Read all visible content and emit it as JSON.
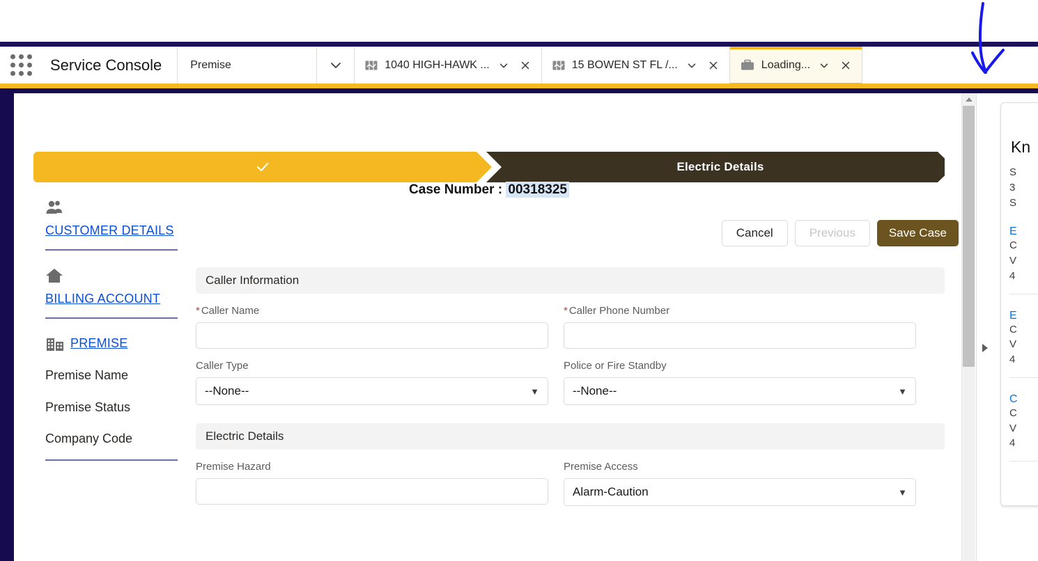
{
  "header": {
    "app_launcher_icon": "app-launcher-grid-icon",
    "app_name": "Service Console",
    "object_tab": "Premise",
    "object_caret_icon": "chevron-down-icon",
    "tabs": [
      {
        "label": "1040 HIGH-HAWK ...",
        "icon": "map-icon",
        "active": false,
        "caret_icon": "chevron-down-icon",
        "close_icon": "close-icon"
      },
      {
        "label": "15 BOWEN ST FL /...",
        "icon": "map-icon",
        "active": false,
        "caret_icon": "chevron-down-icon",
        "close_icon": "close-icon"
      },
      {
        "label": "Loading...",
        "icon": "briefcase-icon",
        "active": true,
        "caret_icon": "chevron-down-icon",
        "close_icon": "close-icon"
      }
    ]
  },
  "path": {
    "completed_step": {
      "label": "",
      "check_icon": "check-icon"
    },
    "current_step": {
      "label": "Electric Details"
    }
  },
  "case": {
    "label": "Case Number :",
    "number": "00318325"
  },
  "actions": {
    "cancel": "Cancel",
    "previous": "Previous",
    "save": "Save Case"
  },
  "leftnav": {
    "blocks": [
      {
        "icon": "customer-people-icon",
        "link": "CUSTOMER DETAILS",
        "fields": []
      },
      {
        "icon": "home-icon",
        "link": "BILLING ACCOUNT",
        "fields": []
      },
      {
        "icon": "building-icon",
        "link": "PREMISE",
        "fields": [
          "Premise Name",
          "Premise Status",
          "Company Code"
        ]
      }
    ]
  },
  "form": {
    "sections": [
      {
        "title": "Caller Information",
        "rows": [
          [
            {
              "label": "Caller Name",
              "required": true,
              "type": "input",
              "value": "",
              "placeholder": ""
            },
            {
              "label": "Caller Phone Number",
              "required": true,
              "type": "input",
              "value": "",
              "placeholder": ""
            }
          ],
          [
            {
              "label": "Caller Type",
              "required": false,
              "type": "select",
              "value": "--None--"
            },
            {
              "label": "Police or Fire Standby",
              "required": false,
              "type": "select",
              "value": "--None--"
            }
          ]
        ]
      },
      {
        "title": "Electric Details",
        "rows": [
          [
            {
              "label": "Premise Hazard",
              "required": false,
              "type": "input",
              "value": "",
              "placeholder": ""
            },
            {
              "label": "Premise Access",
              "required": false,
              "type": "select",
              "value": "Alarm-Caution"
            }
          ]
        ]
      }
    ]
  },
  "right_rail": {
    "toggle_icon": "expand-panel-arrow-icon",
    "card_title": "Kn",
    "card_meta": [
      "S",
      "3",
      "S"
    ],
    "articles": [
      {
        "link": "E",
        "lines": [
          "C",
          "V",
          "4"
        ]
      },
      {
        "link": "E",
        "lines": [
          "C",
          "V",
          "4"
        ]
      },
      {
        "link": "C",
        "lines": [
          "C",
          "V",
          "4"
        ]
      }
    ]
  },
  "scrollbar": {
    "up_icon": "scroll-up-arrow-icon"
  },
  "colors": {
    "navy": "#160b4f",
    "gold": "#f5b820",
    "dark_brown": "#3c3222",
    "save_brown": "#6b5420",
    "link_blue": "#0b4fd9",
    "required_red": "#c23934",
    "highlight_blue": "#d6e6f7",
    "annotation_blue": "#1a1ae6"
  },
  "annotation": {
    "shape": "hand-drawn-down-arrow",
    "points_at": "close-icon-of-loading-tab"
  }
}
